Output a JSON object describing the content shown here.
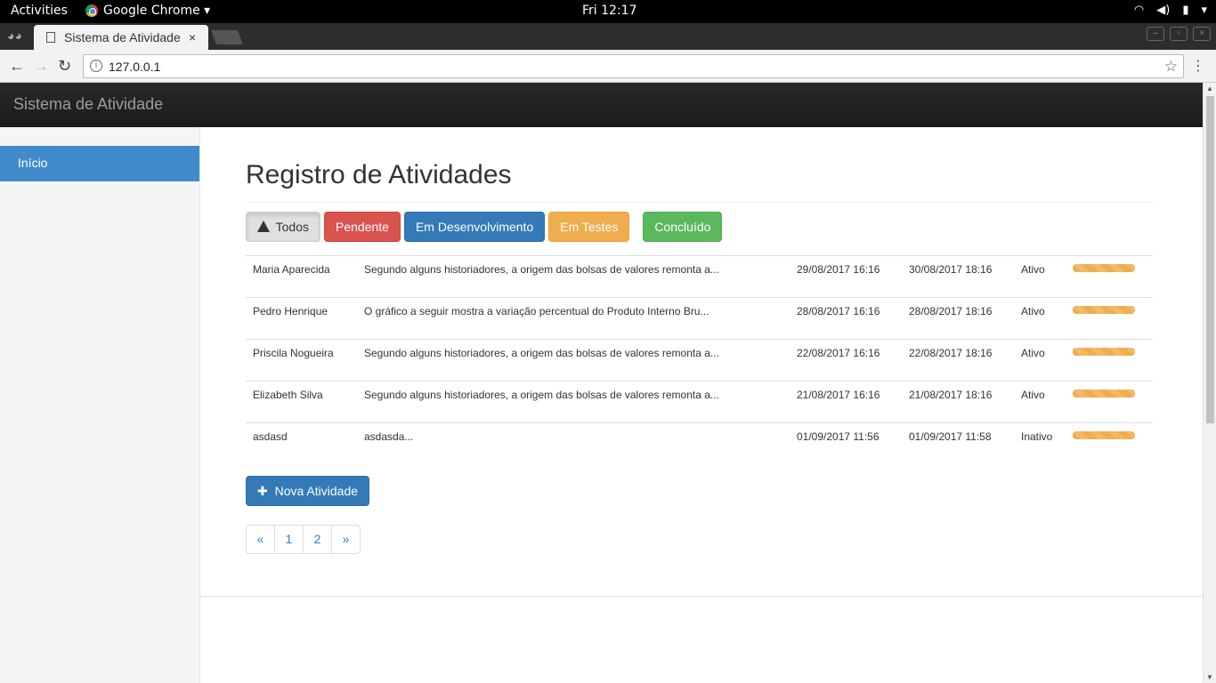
{
  "system_bar": {
    "activities": "Activities",
    "app_name": "Google Chrome ▾",
    "clock": "Fri 12:17",
    "tray_icons": [
      "wifi-icon",
      "volume-icon",
      "battery-icon",
      "power-menu-icon"
    ]
  },
  "browser": {
    "tab_title": "Sistema de Atividade",
    "tab_close": "×",
    "url": "127.0.0.1",
    "back": "←",
    "forward": "→",
    "reload": "↻",
    "star": "☆",
    "menu": "⋮",
    "window_buttons": [
      "–",
      "▫",
      "×"
    ]
  },
  "app": {
    "brand": "Sistema de Atividade",
    "sidebar": {
      "items": [
        {
          "label": "Início",
          "active": true
        }
      ]
    },
    "page_title": "Registro de Atividades",
    "filters": {
      "todos": "Todos",
      "pendente": "Pendente",
      "em_desenvolvimento": "Em Desenvolvimento",
      "em_testes": "Em Testes",
      "concluido": "Concluído"
    },
    "activities": [
      {
        "name": "Maria Aparecida",
        "description": "Segundo alguns historiadores, a origem das bolsas de valores remonta a...",
        "start": "29/08/2017 16:16",
        "end": "30/08/2017 18:16",
        "status": "Ativo",
        "progress_pct": 100
      },
      {
        "name": "Pedro Henrique",
        "description": "O gráfico a seguir mostra a variação percentual do Produto Interno Bru...",
        "start": "28/08/2017 16:16",
        "end": "28/08/2017 18:16",
        "status": "Ativo",
        "progress_pct": 100
      },
      {
        "name": "Priscila Nogueira",
        "description": "Segundo alguns historiadores, a origem das bolsas de valores remonta a...",
        "start": "22/08/2017 16:16",
        "end": "22/08/2017 18:16",
        "status": "Ativo",
        "progress_pct": 100
      },
      {
        "name": "Elizabeth Silva",
        "description": "Segundo alguns historiadores, a origem das bolsas de valores remonta a...",
        "start": "21/08/2017 16:16",
        "end": "21/08/2017 18:16",
        "status": "Ativo",
        "progress_pct": 100
      },
      {
        "name": "asdasd",
        "description": "asdasda...",
        "start": "01/09/2017 11:56",
        "end": "01/09/2017 11:58",
        "status": "Inativo",
        "progress_pct": 100
      }
    ],
    "new_button": "Nova Atividade",
    "pagination": [
      "«",
      "1",
      "2",
      "»"
    ],
    "colors": {
      "primary": "#337ab7",
      "danger": "#d9534f",
      "warning": "#f0ad4e",
      "success": "#5cb85c",
      "sidebar_active": "#428bca"
    }
  }
}
